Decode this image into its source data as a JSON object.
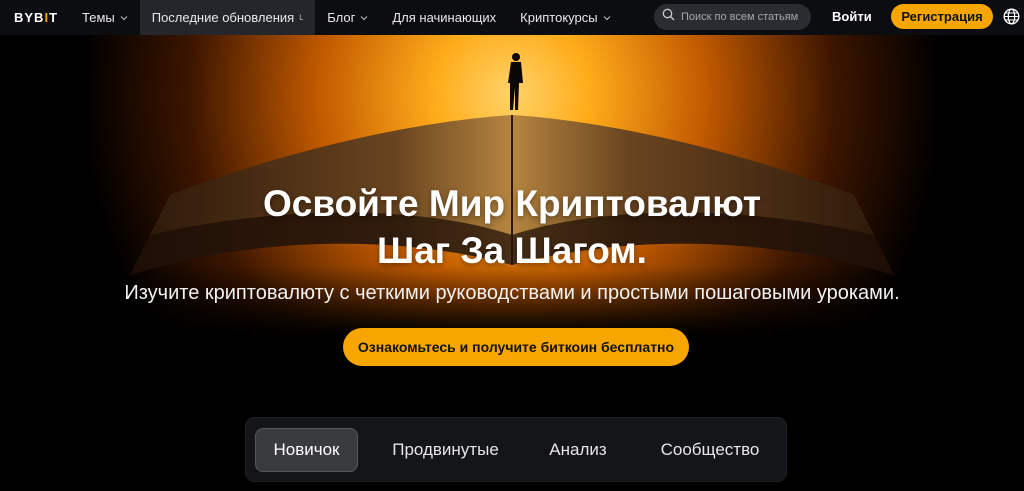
{
  "nav": {
    "logo_main": "BYB",
    "logo_bar": "I",
    "logo_end": "T",
    "items": [
      {
        "label": "Темы",
        "dropdown": true,
        "active": false
      },
      {
        "label": "Последние обновления",
        "dropdown": false,
        "active": true,
        "suffix": "ʟ"
      },
      {
        "label": "Блог",
        "dropdown": true,
        "active": false
      },
      {
        "label": "Для начинающих",
        "dropdown": false,
        "active": false
      },
      {
        "label": "Криптокурсы",
        "dropdown": true,
        "active": false
      }
    ],
    "search_placeholder": "Поиск по всем статьям",
    "login": "Войти",
    "register": "Регистрация"
  },
  "hero": {
    "title_line1": "Освойте Мир Криптовалют",
    "title_line2": "Шаг За Шагом.",
    "subtitle": "Изучите криптовалюту с четкими руководствами и простыми пошаговыми уроками.",
    "cta": "Ознакомьтесь и получите биткоин бесплатно"
  },
  "tabs": [
    {
      "label": "Новичок",
      "active": true
    },
    {
      "label": "Продвинутые",
      "active": false
    },
    {
      "label": "Анализ",
      "active": false
    },
    {
      "label": "Сообщество",
      "active": false
    }
  ],
  "colors": {
    "accent": "#f7a600",
    "nav_bg": "#0c0d10",
    "page_bg": "#000000"
  },
  "icons": {
    "search": "search-icon",
    "globe": "globe-icon",
    "chevron": "chevron-down-icon"
  }
}
